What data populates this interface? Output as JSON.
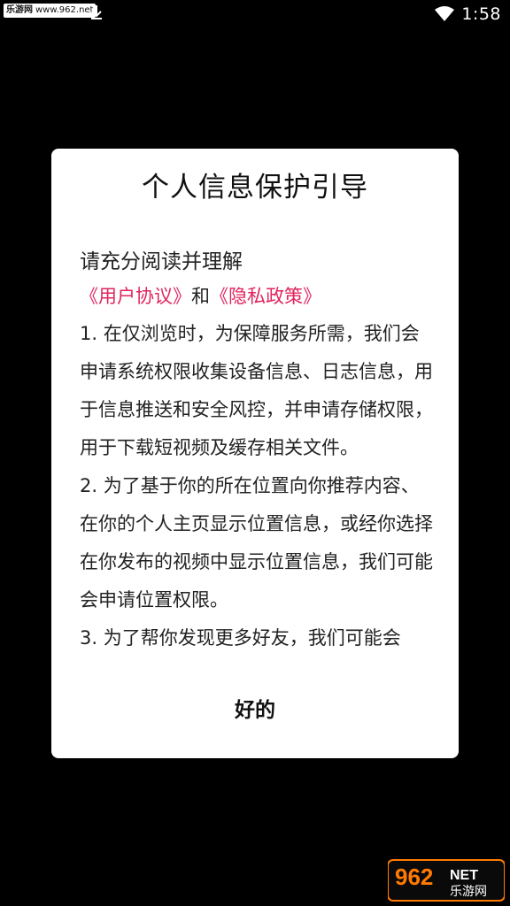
{
  "status_bar": {
    "watermark_site": "乐游网",
    "watermark_url": "www.962.net",
    "time": "1:58"
  },
  "dialog": {
    "title": "个人信息保护引导",
    "intro": "请充分阅读并理解",
    "user_agreement_link": "《用户协议》",
    "and": "和",
    "privacy_policy_link": "《隐私政策》",
    "paragraphs": [
      "1. 在仅浏览时，为保障服务所需，我们会 申请系统权限收集设备信息、日志信息，用于信息推送和安全风控，并申请存储权限，用于下载短视频及缓存相关文件。",
      "2. 为了基于你的所在位置向你推荐内容、在你的个人主页显示位置信息，或经你选择在你发布的视频中显示位置信息，我们可能会申请位置权限。",
      "3. 为了帮你发现更多好友，我们可能会"
    ],
    "confirm_button": "好的"
  },
  "watermark_logo": {
    "brand": "962NET",
    "sub": "乐游网"
  },
  "colors": {
    "background": "#000000",
    "dialog_bg": "#ffffff",
    "link": "#e0245e"
  }
}
